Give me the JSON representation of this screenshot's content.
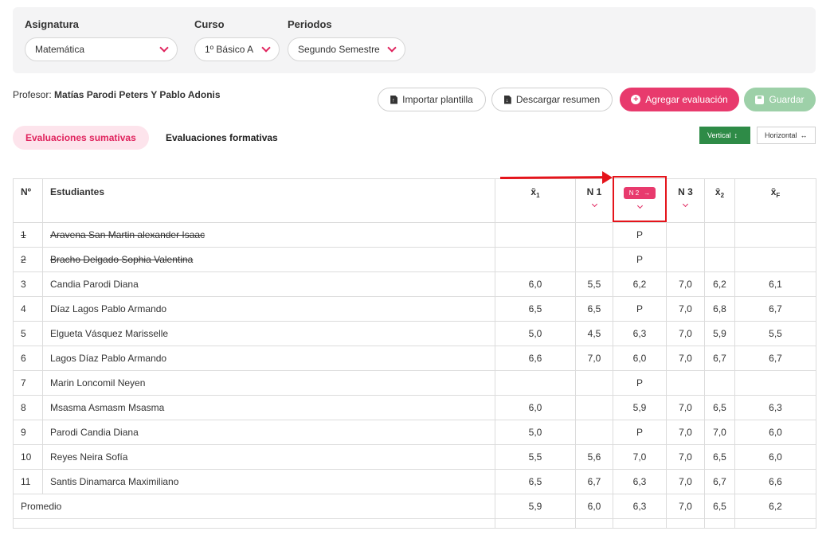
{
  "filters": {
    "subject": {
      "label": "Asignatura",
      "value": "Matemática"
    },
    "course": {
      "label": "Curso",
      "value": "1º Básico A"
    },
    "period": {
      "label": "Periodos",
      "value": "Segundo Semestre"
    }
  },
  "professor": {
    "prefix": "Profesor:",
    "name": "Matías Parodi Peters Y Pablo Adonis"
  },
  "actions": {
    "import_label": "Importar plantilla",
    "download_label": "Descargar resumen",
    "add_label": "Agregar evaluación",
    "save_label": "Guardar"
  },
  "tabs": {
    "summative": "Evaluaciones sumativas",
    "formative": "Evaluaciones formativas"
  },
  "orientation": {
    "vertical": "Vertical",
    "horizontal": "Horizontal"
  },
  "table": {
    "headers": {
      "num": "Nº",
      "students": "Estudiantes",
      "avg1": "x̄",
      "avg1_sub": "1",
      "n1": "N 1",
      "n2": "N 2",
      "n3": "N 3",
      "avg2": "x̄",
      "avg2_sub": "2",
      "avgF": "x̄",
      "avgF_sub": "F"
    },
    "rows": [
      {
        "num": "1",
        "name": "Aravena San Martin alexander Isaac",
        "avg1": "",
        "n1": "",
        "n2": "P",
        "n3": "",
        "avg2": "",
        "avgF": "",
        "withdrawn": true
      },
      {
        "num": "2",
        "name": "Bracho Delgado Sophia Valentina",
        "avg1": "",
        "n1": "",
        "n2": "P",
        "n3": "",
        "avg2": "",
        "avgF": "",
        "withdrawn": true
      },
      {
        "num": "3",
        "name": "Candia Parodi Diana",
        "avg1": "6,0",
        "n1": "5,5",
        "n2": "6,2",
        "n3": "7,0",
        "avg2": "6,2",
        "avgF": "6,1"
      },
      {
        "num": "4",
        "name": "Díaz Lagos Pablo Armando",
        "avg1": "6,5",
        "n1": "6,5",
        "n2": "P",
        "n3": "7,0",
        "avg2": "6,8",
        "avgF": "6,7"
      },
      {
        "num": "5",
        "name": "Elgueta Vásquez Marisselle",
        "avg1": "5,0",
        "n1": "4,5",
        "n2": "6,3",
        "n3": "7,0",
        "avg2": "5,9",
        "avgF": "5,5"
      },
      {
        "num": "6",
        "name": "Lagos Díaz Pablo Armando",
        "avg1": "6,6",
        "n1": "7,0",
        "n2": "6,0",
        "n3": "7,0",
        "avg2": "6,7",
        "avgF": "6,7"
      },
      {
        "num": "7",
        "name": "Marin Loncomil Neyen",
        "avg1": "",
        "n1": "",
        "n2": "P",
        "n3": "",
        "avg2": "",
        "avgF": ""
      },
      {
        "num": "8",
        "name": "Msasma Asmasm Msasma",
        "avg1": "6,0",
        "n1": "",
        "n2": "5,9",
        "n3": "7,0",
        "avg2": "6,5",
        "avgF": "6,3"
      },
      {
        "num": "9",
        "name": "Parodi Candia Diana",
        "avg1": "5,0",
        "n1": "",
        "n2": "P",
        "n3": "7,0",
        "avg2": "7,0",
        "avgF": "6,0"
      },
      {
        "num": "10",
        "name": "Reyes Neira Sofía",
        "avg1": "5,5",
        "n1": "5,6",
        "n2": "7,0",
        "n3": "7,0",
        "avg2": "6,5",
        "avgF": "6,0"
      },
      {
        "num": "11",
        "name": "Santis Dinamarca Maximiliano",
        "avg1": "6,5",
        "n1": "6,7",
        "n2": "6,3",
        "n3": "7,0",
        "avg2": "6,7",
        "avgF": "6,6"
      }
    ],
    "average": {
      "label": "Promedio",
      "avg1": "5,9",
      "n1": "6,0",
      "n2": "6,3",
      "n3": "7,0",
      "avg2": "6,5",
      "avgF": "6,2"
    }
  },
  "colors": {
    "accent": "#e83a6d",
    "success": "#2e8b47",
    "annotation": "#e5141b"
  }
}
